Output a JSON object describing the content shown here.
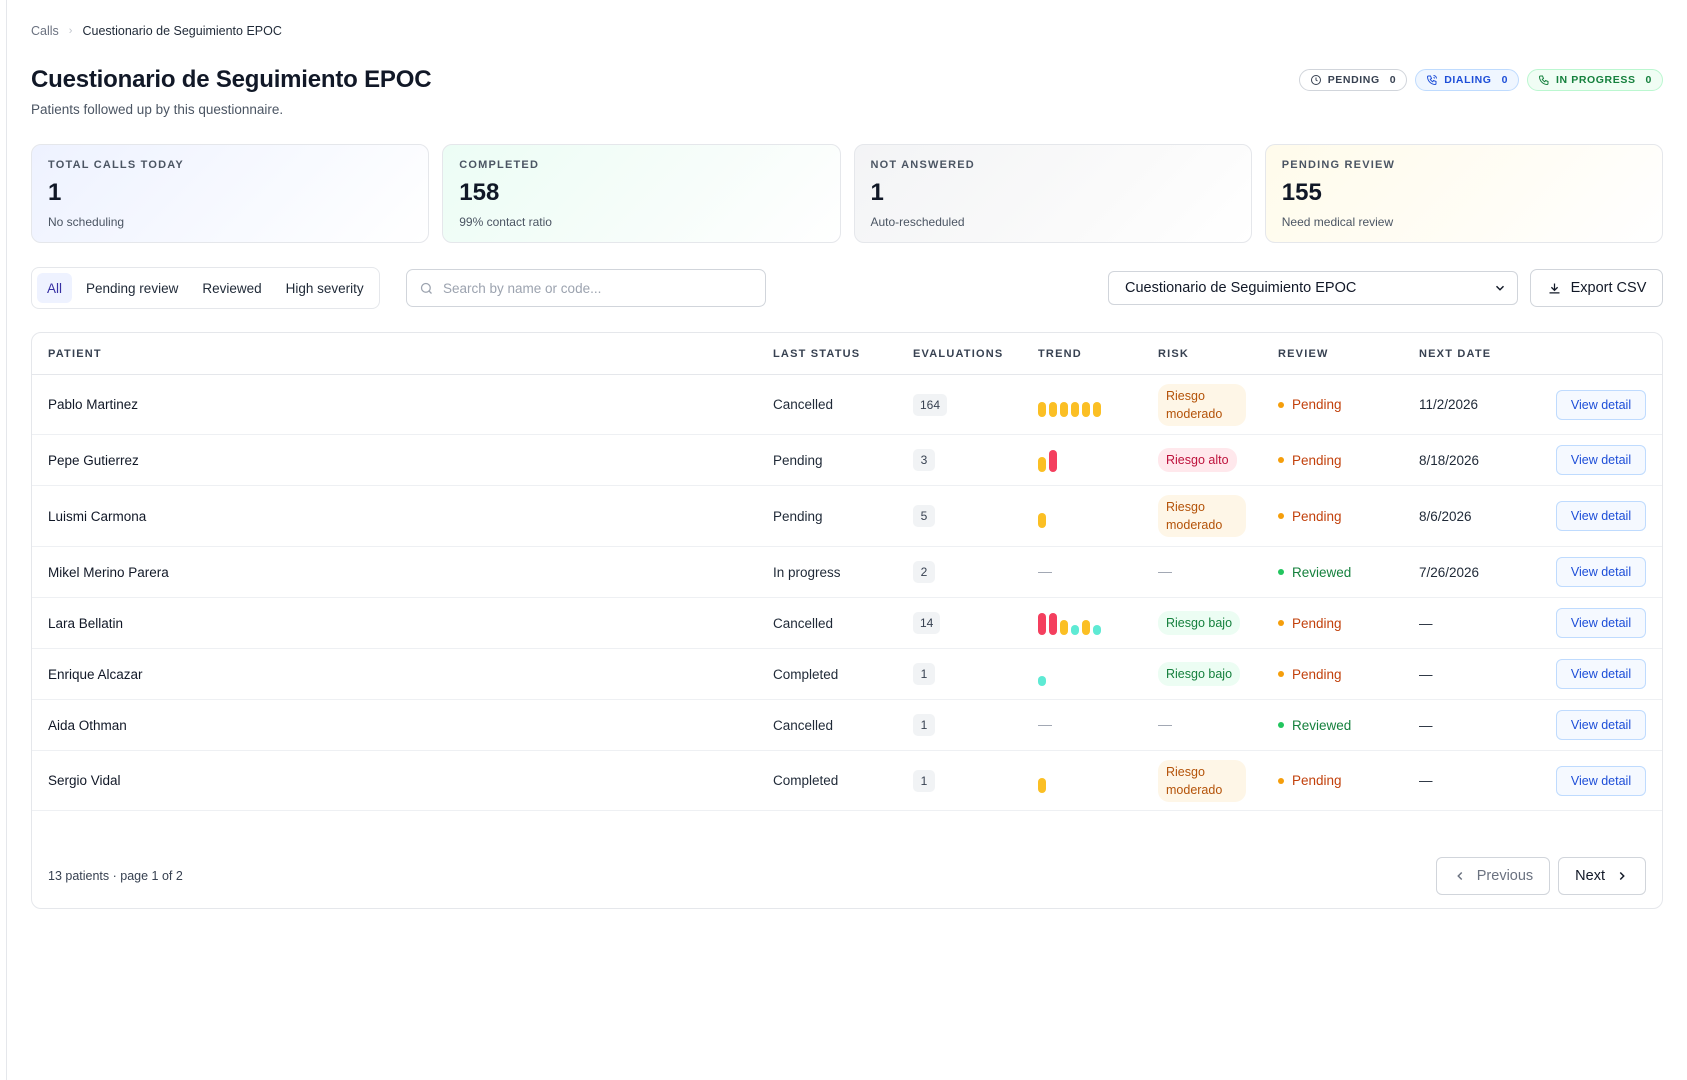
{
  "breadcrumb": {
    "root": "Calls",
    "current": "Cuestionario de Seguimiento EPOC"
  },
  "header": {
    "title": "Cuestionario de Seguimiento EPOC",
    "subtitle": "Patients followed up by this questionnaire."
  },
  "status_pills": {
    "pending": {
      "label": "PENDING",
      "count": "0"
    },
    "dialing": {
      "label": "DIALING",
      "count": "0"
    },
    "in_progress": {
      "label": "IN PROGRESS",
      "count": "0"
    }
  },
  "kpis": [
    {
      "label": "TOTAL CALLS TODAY",
      "value": "1",
      "sub": "No scheduling"
    },
    {
      "label": "COMPLETED",
      "value": "158",
      "sub": "99% contact ratio"
    },
    {
      "label": "NOT ANSWERED",
      "value": "1",
      "sub": "Auto-rescheduled"
    },
    {
      "label": "PENDING REVIEW",
      "value": "155",
      "sub": "Need medical review"
    }
  ],
  "filters": {
    "tabs": [
      "All",
      "Pending review",
      "Reviewed",
      "High severity"
    ],
    "active": "All"
  },
  "search": {
    "placeholder": "Search by name or code...",
    "value": ""
  },
  "questionnaire_select": {
    "value": "Cuestionario de Seguimiento EPOC"
  },
  "export_label": "Export CSV",
  "colors": {
    "amber": "#fbbf24",
    "red": "#f43f5e",
    "teal": "#5eead4"
  },
  "table": {
    "headers": {
      "patient": "PATIENT",
      "last_status": "LAST STATUS",
      "evaluations": "EVALUATIONS",
      "trend": "TREND",
      "risk": "RISK",
      "review": "REVIEW",
      "next_date": "NEXT DATE"
    },
    "view_label": "View detail",
    "rows": [
      {
        "patient": "Pablo Martinez",
        "status": "Cancelled",
        "evaluations": "164",
        "trend": [
          [
            "amber",
            0.5
          ],
          [
            "amber",
            0.5
          ],
          [
            "amber",
            0.5
          ],
          [
            "amber",
            0.5
          ],
          [
            "amber",
            0.5
          ],
          [
            "amber",
            0.5
          ]
        ],
        "risk": {
          "label": "Riesgo moderado",
          "level": "mod"
        },
        "review": "Pending",
        "next_date": "11/2/2026"
      },
      {
        "patient": "Pepe Gutierrez",
        "status": "Pending",
        "evaluations": "3",
        "trend": [
          [
            "amber",
            0.5
          ],
          [
            "red",
            0.9
          ]
        ],
        "risk": {
          "label": "Riesgo alto",
          "level": "alto"
        },
        "review": "Pending",
        "next_date": "8/18/2026"
      },
      {
        "patient": "Luismi Carmona",
        "status": "Pending",
        "evaluations": "5",
        "trend": [
          [
            "amber",
            0.5
          ]
        ],
        "risk": {
          "label": "Riesgo moderado",
          "level": "mod"
        },
        "review": "Pending",
        "next_date": "8/6/2026"
      },
      {
        "patient": "Mikel Merino Parera",
        "status": "In progress",
        "evaluations": "2",
        "trend": [],
        "risk": null,
        "review": "Reviewed",
        "next_date": "7/26/2026"
      },
      {
        "patient": "Lara Bellatin",
        "status": "Cancelled",
        "evaluations": "14",
        "trend": [
          [
            "red",
            0.9
          ],
          [
            "red",
            0.9
          ],
          [
            "amber",
            0.5
          ],
          [
            "teal",
            0.2
          ],
          [
            "amber",
            0.5
          ],
          [
            "teal",
            0.2
          ]
        ],
        "risk": {
          "label": "Riesgo bajo",
          "level": "bajo"
        },
        "review": "Pending",
        "next_date": "—"
      },
      {
        "patient": "Enrique Alcazar",
        "status": "Completed",
        "evaluations": "1",
        "trend": [
          [
            "teal",
            0.2
          ]
        ],
        "risk": {
          "label": "Riesgo bajo",
          "level": "bajo"
        },
        "review": "Pending",
        "next_date": "—"
      },
      {
        "patient": "Aida Othman",
        "status": "Cancelled",
        "evaluations": "1",
        "trend": [],
        "risk": null,
        "review": "Reviewed",
        "next_date": "—"
      },
      {
        "patient": "Sergio Vidal",
        "status": "Completed",
        "evaluations": "1",
        "trend": [
          [
            "amber",
            0.5
          ]
        ],
        "risk": {
          "label": "Riesgo moderado",
          "level": "mod"
        },
        "review": "Pending",
        "next_date": "—"
      }
    ],
    "empty_placeholder": "—"
  },
  "pagination": {
    "summary": "13 patients · page 1 of 2",
    "previous": "Previous",
    "next": "Next"
  }
}
